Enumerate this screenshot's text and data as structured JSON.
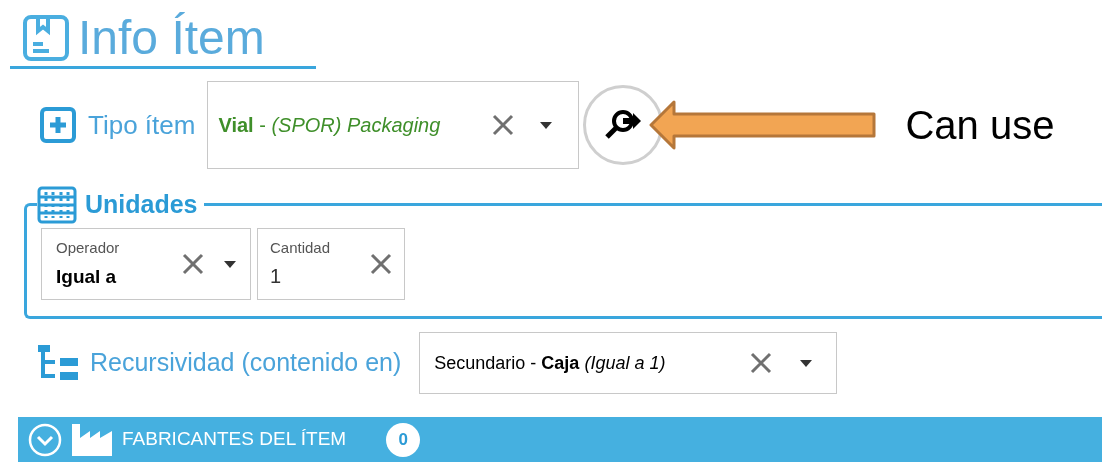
{
  "header": {
    "title": "Info Ítem"
  },
  "item_type": {
    "label": "Tipo ítem",
    "value": "**Vial** - *(SPOR) Packaging*"
  },
  "annotation": {
    "text": "Can use"
  },
  "units": {
    "title": "Unidades",
    "operator": {
      "label": "Operador",
      "value": "Igual a"
    },
    "quantity": {
      "label": "Cantidad",
      "value": "1"
    }
  },
  "recursion": {
    "label": "Recursividad (contenido en)",
    "value": "Secundario - **Caja** *(Igual a 1)*"
  },
  "manufacturers": {
    "title": "FABRICANTES DEL ÍTEM",
    "count": "0"
  }
}
